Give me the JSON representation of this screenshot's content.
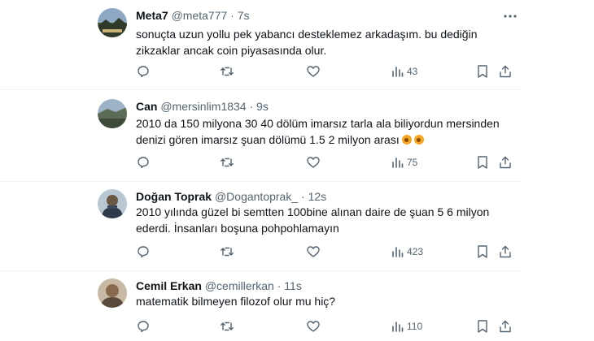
{
  "tweets": [
    {
      "name": "Meta7",
      "handle": "@meta777",
      "dot": "·",
      "time": "7s",
      "line1": "sonuçta uzun yollu pek yabancı desteklemez arkadaşım. bu dediğin",
      "line2": "zikzaklar ancak coin piyasasında olur.",
      "views": "43"
    },
    {
      "name": "Can",
      "handle": "@mersinlim1834",
      "dot": "·",
      "time": "9s",
      "line1": "2010 da 150 milyona 30 40 dölüm imarsız tarla ala biliyordun mersinden",
      "line2": "denizi gören imarsız şuan dölümü 1.5 2 milyon arası",
      "views": "75"
    },
    {
      "name": "Doğan Toprak",
      "handle": "@Dogantoprak_",
      "dot": "·",
      "time": "12s",
      "line1": "2010 yılında güzel bi semtten 100bine alınan daire de şuan 5 6 milyon",
      "line2": "ederdi. İnsanları boşuna pohpohlamayın",
      "views": "423"
    },
    {
      "name": "Cemil Erkan",
      "handle": "@cemillerkan",
      "dot": "·",
      "time": "11s",
      "line1": "matematik bilmeyen filozof olur mu hiç?",
      "line2": "",
      "views": "110"
    }
  ],
  "icons": {
    "more": "more-horizontal-icon",
    "reply": "reply-icon",
    "retweet": "retweet-icon",
    "like": "like-icon",
    "views": "views-icon",
    "bookmark": "bookmark-icon",
    "share": "share-icon"
  },
  "colors": {
    "text": "#0f1419",
    "secondary": "#536471",
    "divider": "#eff3f4"
  }
}
